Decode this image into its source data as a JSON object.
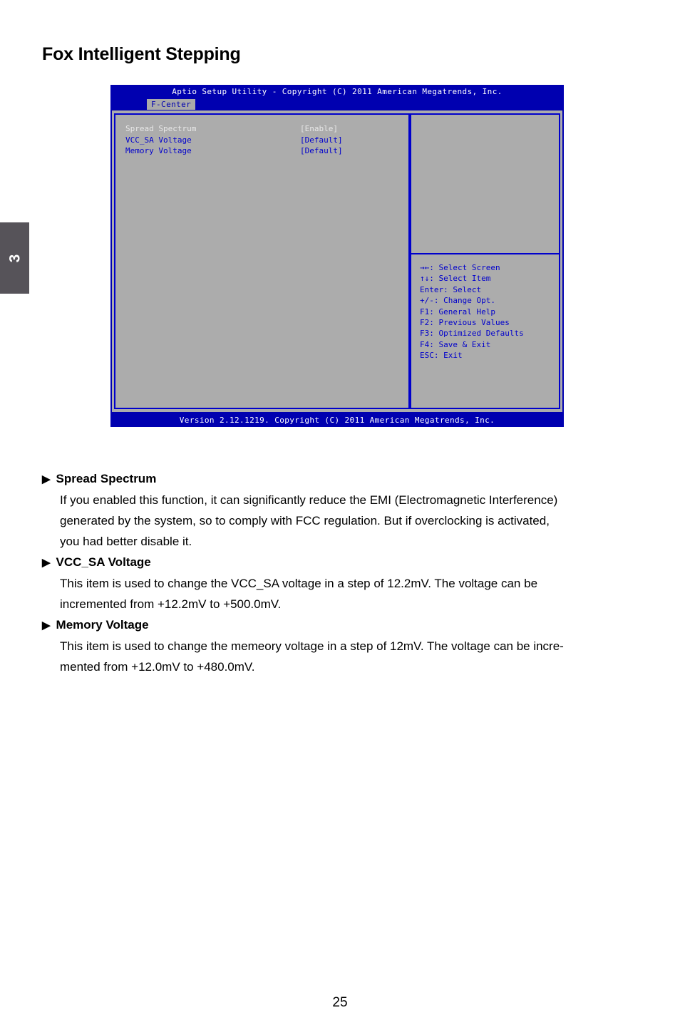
{
  "chapter_tab": {
    "number": "3"
  },
  "page_title": "Fox Intelligent Stepping",
  "bios": {
    "titlebar": "Aptio Setup Utility - Copyright (C) 2011 American Megatrends, Inc.",
    "active_tab": "F-Center",
    "settings": [
      {
        "name": "Spread Spectrum",
        "value": "[Enable]",
        "highlighted": true
      },
      {
        "name": "VCC_SA Voltage",
        "value": "[Default]",
        "highlighted": false
      },
      {
        "name": "Memory Voltage",
        "value": "[Default]",
        "highlighted": false
      }
    ],
    "help_keys": [
      "→←: Select Screen",
      "↑↓: Select Item",
      "Enter: Select",
      "+/-: Change Opt.",
      "F1: General Help",
      "F2: Previous Values",
      "F3: Optimized Defaults",
      "F4: Save & Exit",
      "ESC: Exit"
    ],
    "footer": "Version 2.12.1219. Copyright (C) 2011 American Megatrends, Inc.",
    "colors": {
      "chrome_blue": "#0000b0",
      "panel_gray": "#acacac",
      "border_blue": "#0000cc",
      "text_blue": "#0000cc",
      "text_white": "#e8e8e8"
    }
  },
  "options": [
    {
      "bullet": "▶",
      "title": "Spread Spectrum",
      "lines": [
        "If you enabled this function, it can significantly reduce the EMI (Electromagnetic Interference)",
        "generated by the system, so to comply with FCC regulation. But if overclocking is activated,",
        "you had better disable it."
      ]
    },
    {
      "bullet": "▶",
      "title": "VCC_SA Voltage",
      "lines": [
        "This item is used to change the VCC_SA voltage in a step of 12.2mV. The voltage can be",
        "incremented from +12.2mV to +500.0mV."
      ]
    },
    {
      "bullet": "▶",
      "title": "Memory Voltage",
      "lines": [
        "This item is used to change the memeory voltage in a step of 12mV. The voltage can be incre-",
        "mented from +12.0mV to +480.0mV."
      ]
    }
  ],
  "page_number": "25"
}
